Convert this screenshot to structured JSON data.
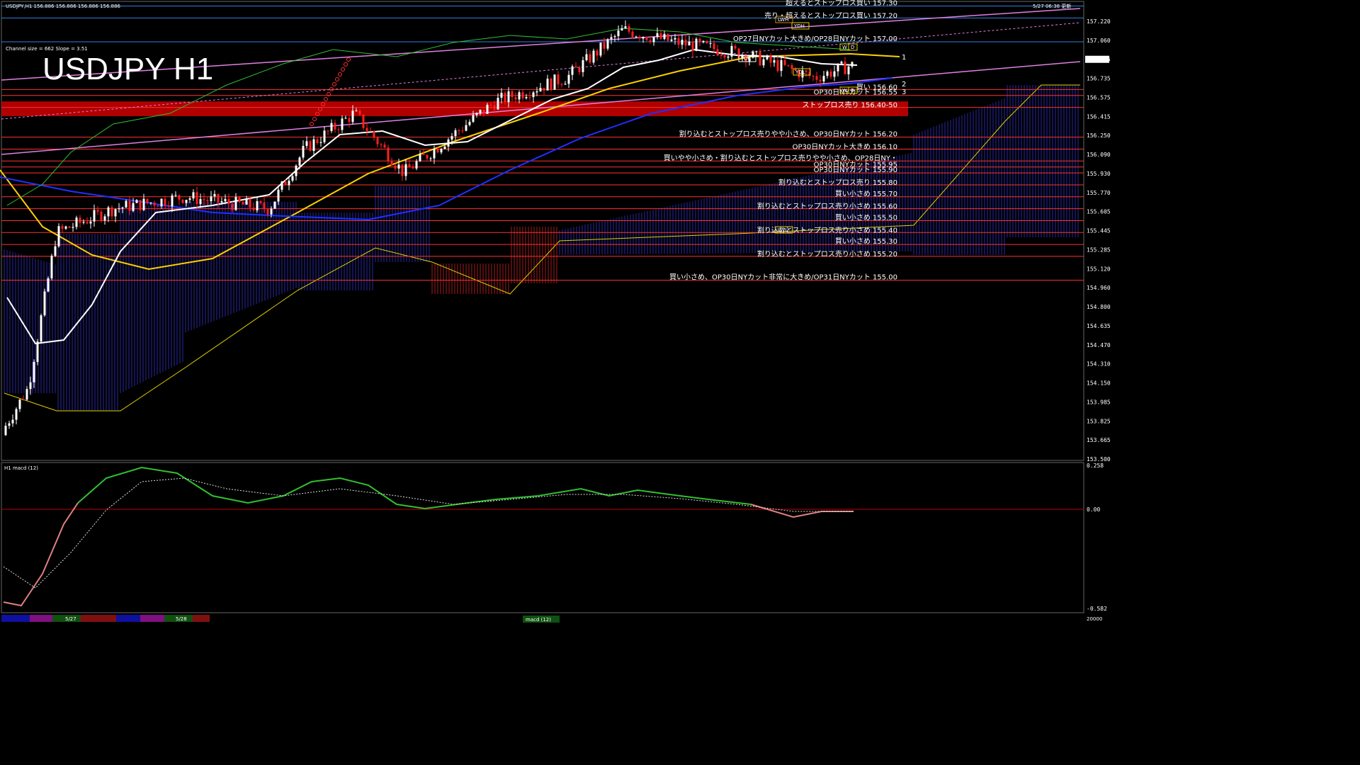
{
  "header": {
    "symbol_info": "USDJPY,H1  156.886 156.886 156.886 156.886",
    "timestamp": "5/27 06:38 更新",
    "channel_info": "Channel size = 662 Slope = 3.51",
    "big_title": "USDJPY H1",
    "macd_label": "H1  macd (12)"
  },
  "chart_data": {
    "type": "candlestick",
    "title": "USDJPY H1",
    "price_axis": {
      "min": 153.5,
      "max": 157.22,
      "ticks": [
        "157.220",
        "157.060",
        "156.886",
        "156.735",
        "156.575",
        "156.415",
        "156.250",
        "156.090",
        "155.930",
        "155.770",
        "155.605",
        "155.445",
        "155.285",
        "155.120",
        "154.960",
        "154.800",
        "154.635",
        "154.470",
        "154.310",
        "154.150",
        "153.985",
        "153.825",
        "153.665",
        "153.500"
      ],
      "current_price": "156.886"
    },
    "macd_axis": {
      "ticks": [
        "0.258",
        "0.00",
        "-0.582"
      ],
      "bottom": "20000"
    },
    "levels": [
      {
        "price": 157.3,
        "label": "超えるとストップロス買い 157.30"
      },
      {
        "price": 157.2,
        "label": "売り・超えるとストップロス買い 157.20"
      },
      {
        "price": 157.0,
        "label": "OP27日NYカット大きめ/OP28日NYカット 157.00"
      },
      {
        "price": 156.6,
        "label": "買い 156.60"
      },
      {
        "price": 156.55,
        "label": "OP30日NYカット 156.55"
      },
      {
        "price": 156.45,
        "label": "ストップロス売り 156.40-50"
      },
      {
        "price": 156.2,
        "label": "割り込むとストップロス売りやや小さめ、OP30日NYカット 156.20"
      },
      {
        "price": 156.1,
        "label": "OP30日NYカット大きめ 156.10"
      },
      {
        "price": 156.0,
        "label": "買いやや小さめ・割り込むとストップロス売りやや小さめ、OP28日NY・"
      },
      {
        "price": 155.95,
        "label": "OP30日NYカット 155.95"
      },
      {
        "price": 155.9,
        "label": "OP30日NYカット 155.90"
      },
      {
        "price": 155.8,
        "label": "割り込むとストップロス売り 155.80"
      },
      {
        "price": 155.7,
        "label": "買い小さめ 155.70"
      },
      {
        "price": 155.6,
        "label": "割り込むとストップロス売り小さめ 155.60"
      },
      {
        "price": 155.5,
        "label": "買い小さめ 155.50"
      },
      {
        "price": 155.4,
        "label": "割り込むとストップロス売り小さめ 155.40"
      },
      {
        "price": 155.3,
        "label": "買い小さめ 155.30"
      },
      {
        "price": 155.2,
        "label": "割り込むとストップロス売り小さめ 155.20"
      },
      {
        "price": 155.0,
        "label": "買い小さめ、OP30日NYカット非常に大きめ/OP31日NYカット 155.00"
      }
    ],
    "markers": {
      "ydh": "YDH",
      "lwh": "LWH",
      "ydc": "YDC",
      "ydl": "YDL",
      "lwl": "LWL",
      "wd1": "W",
      "wd2": "D",
      "n1": "1",
      "n2": "2",
      "n3": "3"
    },
    "date_labels": [
      "5/27",
      "5/28"
    ],
    "macd_tab": "macd (12)"
  },
  "colors": {
    "resistance": "#ff3030",
    "support_band": "#b00000",
    "channel": "#e080e0",
    "kumo": "#3030c0",
    "sma_white": "#ffffff",
    "sma_yellow": "#ffd000",
    "sma_blue": "#2030ff",
    "macd_green": "#30c030",
    "macd_pink": "#e08080"
  }
}
